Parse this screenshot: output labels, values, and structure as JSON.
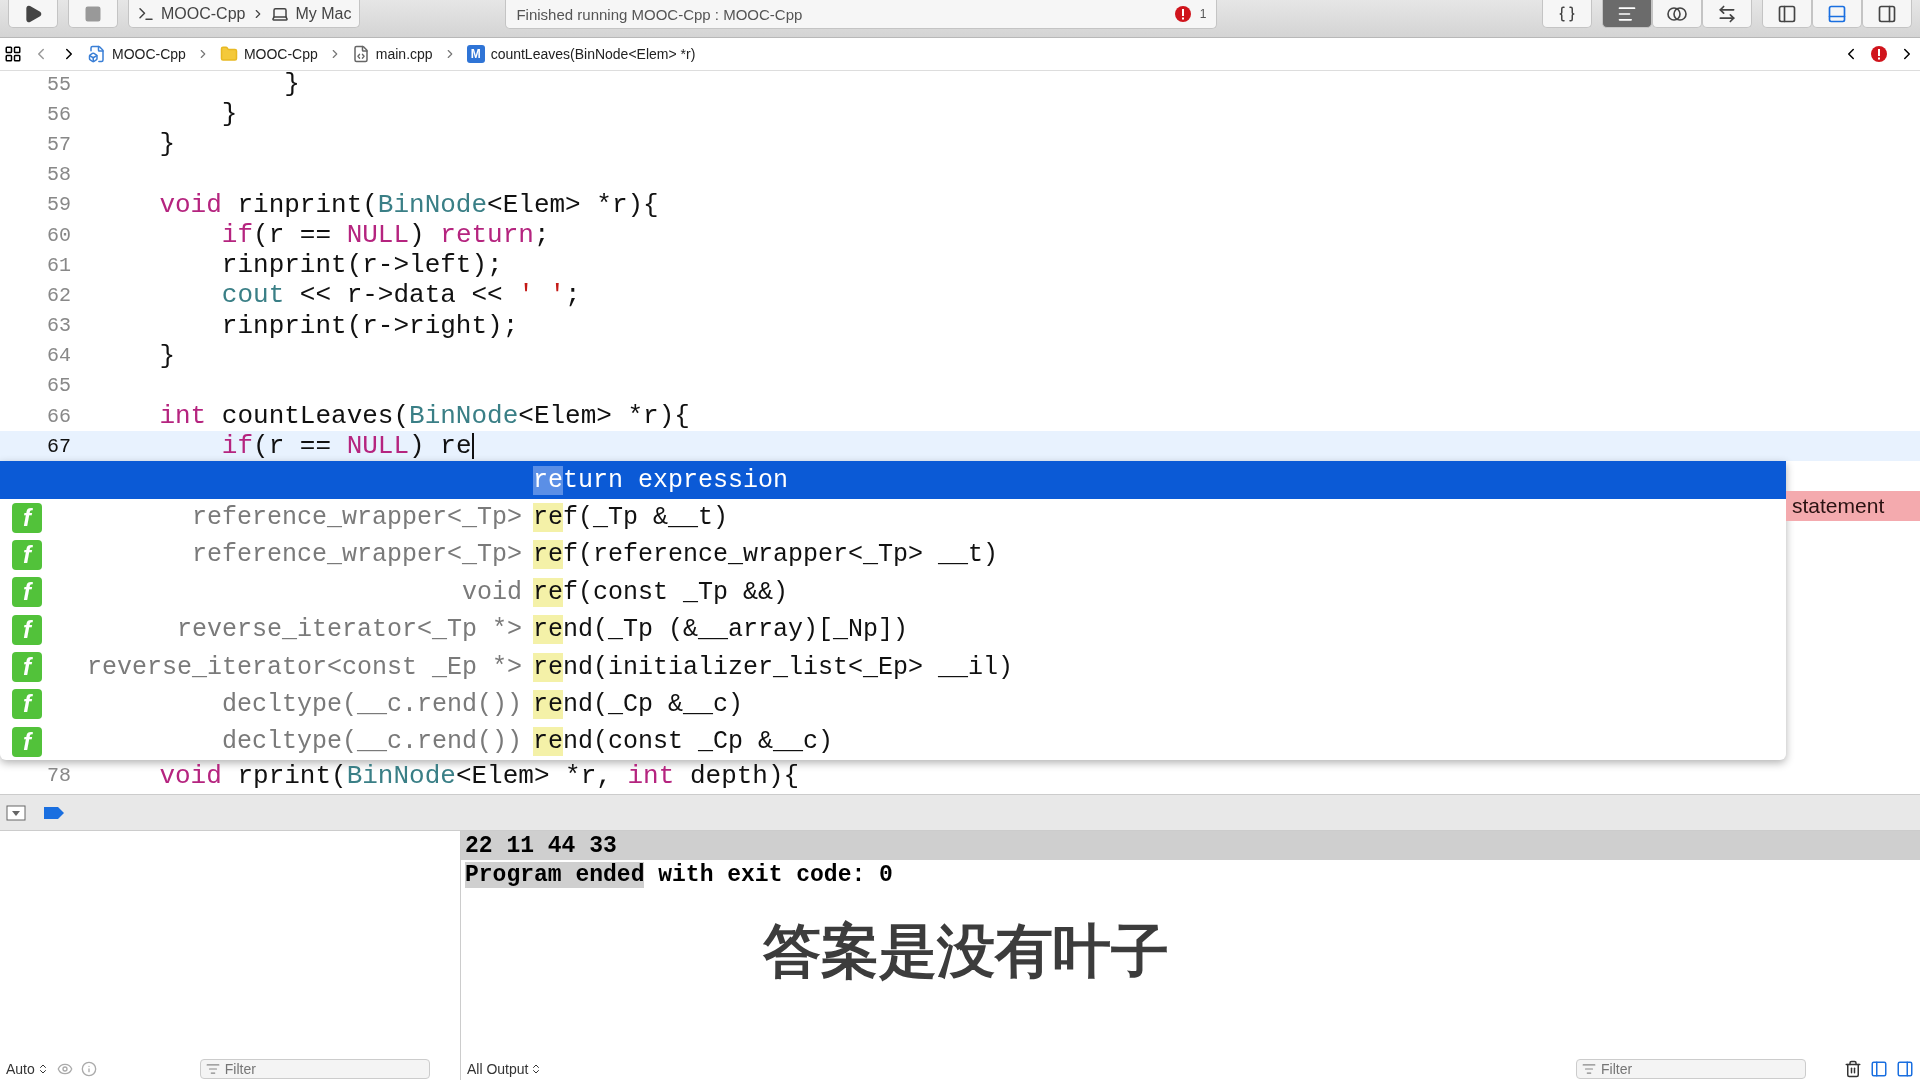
{
  "toolbar": {
    "scheme": {
      "target": "MOOC-Cpp",
      "device": "My Mac"
    },
    "status": "Finished running MOOC-Cpp : MOOC-Cpp",
    "issue_count": "1",
    "editor_modes": [
      {
        "kind": "standard",
        "selected": true
      },
      {
        "kind": "assistant",
        "selected": false
      },
      {
        "kind": "version",
        "selected": false
      }
    ],
    "panels": [
      {
        "kind": "left",
        "selected": false
      },
      {
        "kind": "bottom",
        "selected": true
      },
      {
        "kind": "right",
        "selected": false
      }
    ]
  },
  "jump_bar": {
    "crumbs": [
      {
        "kind": "project",
        "label": "MOOC-Cpp"
      },
      {
        "kind": "folder",
        "label": "MOOC-Cpp"
      },
      {
        "kind": "file",
        "label": "main.cpp"
      },
      {
        "kind": "method",
        "badge": "M",
        "label": "countLeaves(BinNode<Elem> *r)"
      }
    ]
  },
  "editor": {
    "lines": [
      {
        "number": "55",
        "current": false,
        "tokens": [
          {
            "kind": "plain",
            "text": "            }"
          }
        ]
      },
      {
        "number": "56",
        "current": false,
        "tokens": [
          {
            "kind": "plain",
            "text": "        }"
          }
        ]
      },
      {
        "number": "57",
        "current": false,
        "tokens": [
          {
            "kind": "plain",
            "text": "    }"
          }
        ]
      },
      {
        "number": "58",
        "current": false
      },
      {
        "number": "59",
        "current": false,
        "tokens": [
          {
            "kind": "keyword",
            "text": "    void"
          },
          {
            "kind": "plain",
            "text": " rinprint("
          },
          {
            "kind": "type",
            "text": "BinNode"
          },
          {
            "kind": "plain",
            "text": "<Elem> *r){"
          }
        ]
      },
      {
        "number": "60",
        "current": false,
        "tokens": [
          {
            "kind": "keyword",
            "text": "        if"
          },
          {
            "kind": "plain",
            "text": "(r == "
          },
          {
            "kind": "keyword",
            "text": "NULL"
          },
          {
            "kind": "plain",
            "text": ") "
          },
          {
            "kind": "keyword",
            "text": "return"
          },
          {
            "kind": "plain",
            "text": ";"
          }
        ]
      },
      {
        "number": "61",
        "current": false,
        "tokens": [
          {
            "kind": "plain",
            "text": "        rinprint(r->left);"
          }
        ]
      },
      {
        "number": "62",
        "current": false,
        "tokens": [
          {
            "kind": "type",
            "text": "        cout"
          },
          {
            "kind": "plain",
            "text": " << r->data << "
          },
          {
            "kind": "string",
            "text": "' '"
          },
          {
            "kind": "plain",
            "text": ";"
          }
        ]
      },
      {
        "number": "63",
        "current": false,
        "tokens": [
          {
            "kind": "plain",
            "text": "        rinprint(r->right);"
          }
        ]
      },
      {
        "number": "64",
        "current": false,
        "tokens": [
          {
            "kind": "plain",
            "text": "    }"
          }
        ]
      },
      {
        "number": "65",
        "current": false
      },
      {
        "number": "66",
        "current": false,
        "tokens": [
          {
            "kind": "keyword",
            "text": "    int"
          },
          {
            "kind": "plain",
            "text": " countLeaves("
          },
          {
            "kind": "type",
            "text": "BinNode"
          },
          {
            "kind": "plain",
            "text": "<Elem> *r){"
          }
        ]
      },
      {
        "number": "67",
        "current": true,
        "tokens": [
          {
            "kind": "keyword",
            "text": "        if"
          },
          {
            "kind": "plain",
            "text": "(r == "
          },
          {
            "kind": "keyword",
            "text": "NULL"
          },
          {
            "kind": "plain",
            "text": ") re"
          }
        ]
      }
    ],
    "completion": [
      {
        "kind": "snippet",
        "selected": true,
        "match": "re",
        "rest": "turn expression"
      },
      {
        "kind": "function",
        "icon_glyph": "f",
        "selected": false,
        "return_type": "reference_wrapper<_Tp>",
        "match": "re",
        "rest": "f(_Tp &__t)"
      },
      {
        "kind": "function",
        "icon_glyph": "f",
        "selected": false,
        "return_type": "reference_wrapper<_Tp>",
        "match": "re",
        "rest": "f(reference_wrapper<_Tp> __t)"
      },
      {
        "kind": "function",
        "icon_glyph": "f",
        "selected": false,
        "return_type": "void",
        "match": "re",
        "rest": "f(const _Tp &&)"
      },
      {
        "kind": "function",
        "icon_glyph": "f",
        "selected": false,
        "return_type": "reverse_iterator<_Tp *>",
        "match": "re",
        "rest": "nd(_Tp (&__array)[_Np])"
      },
      {
        "kind": "function",
        "icon_glyph": "f",
        "selected": false,
        "return_type": "reverse_iterator<const _Ep *>",
        "match": "re",
        "rest": "nd(initializer_list<_Ep> __il)"
      },
      {
        "kind": "function",
        "icon_glyph": "f",
        "selected": false,
        "return_type": "decltype(__c.rend())",
        "match": "re",
        "rest": "nd(_Cp &__c)"
      },
      {
        "kind": "function",
        "icon_glyph": "f",
        "selected": false,
        "return_type": "decltype(__c.rend())",
        "match": "re",
        "rest": "nd(const _Cp &__c)"
      }
    ],
    "issue": "statement",
    "lines_after": [
      {
        "number": "78",
        "current": false,
        "tokens": [
          {
            "kind": "keyword",
            "text": "    void"
          },
          {
            "kind": "plain",
            "text": " rprint("
          },
          {
            "kind": "type",
            "text": "BinNode"
          },
          {
            "kind": "plain",
            "text": "<Elem> *r, "
          },
          {
            "kind": "keyword",
            "text": "int"
          },
          {
            "kind": "plain",
            "text": " depth){"
          }
        ]
      }
    ]
  },
  "console": {
    "lines": [
      {
        "highlighted": true,
        "segments": [
          {
            "text": "22 11 44 33"
          }
        ]
      },
      {
        "highlighted": false,
        "segments": [
          {
            "text": "Program ended",
            "highlighted": true
          },
          {
            "text": " with exit code: 0",
            "highlighted": false
          }
        ]
      }
    ],
    "subtitle": "答案是没有叶子"
  },
  "bottom_bar": {
    "variables_scope": "Auto",
    "variables_filter": {
      "placeholder": "Filter"
    },
    "output_scope": "All Output",
    "output_filter": {
      "placeholder": "Filter"
    }
  }
}
